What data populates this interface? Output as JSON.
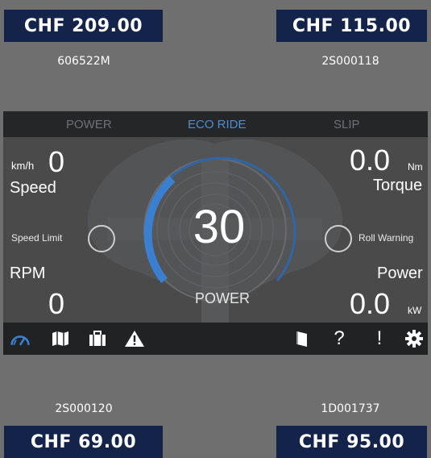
{
  "listings": {
    "top_left": {
      "price": "CHF 209.00",
      "sku": "606522M"
    },
    "top_right": {
      "price": "CHF 115.00",
      "sku": "2S000118"
    },
    "bottom_left": {
      "price": "CHF 69.00",
      "sku": "2S000120"
    },
    "bottom_right": {
      "price": "CHF 95.00",
      "sku": "1D001737"
    }
  },
  "dashboard": {
    "modes": {
      "power": "POWER",
      "eco": "ECO RIDE",
      "slip": "SLIP"
    },
    "active_mode": "ECO RIDE",
    "speed": {
      "unit": "km/h",
      "value": "0",
      "label": "Speed"
    },
    "torque": {
      "value": "0.0",
      "unit": "Nm",
      "label": "Torque"
    },
    "speed_limit_label": "Speed Limit",
    "roll_warning_label": "Roll Warning",
    "rpm": {
      "label": "RPM",
      "value": "0"
    },
    "power": {
      "label": "Power",
      "value": "0.0",
      "unit": "kW"
    },
    "center": {
      "value": "30",
      "label": "POWER"
    },
    "gauge_level": 0.3,
    "toolbar": {
      "left_icons": [
        "gauge-icon",
        "map-icon",
        "briefcase-icon",
        "warning-icon"
      ],
      "right_icons": [
        "book-icon",
        "help-icon",
        "alert-icon",
        "settings-icon"
      ],
      "help_text": "?",
      "alert_text": "!"
    }
  },
  "colors": {
    "price_tag": "#13234a",
    "accent_blue": "#3a7fd0",
    "frame_gray": "#6f6f6f"
  }
}
